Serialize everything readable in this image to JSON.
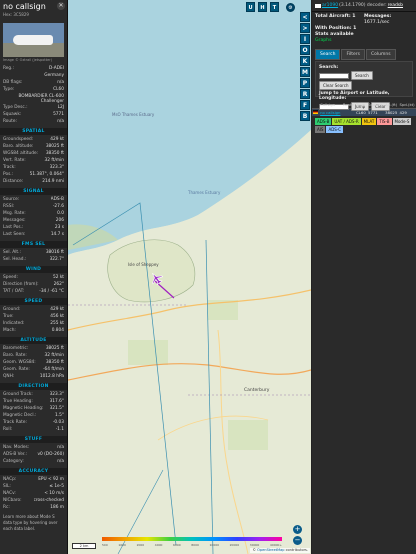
{
  "aircraft": {
    "callsign": "no callsign",
    "hex_line": "Hex: 3C5829",
    "photo_credit": "Image © Oztrail (jetspotter)",
    "fields": [
      {
        "label": "Reg.:",
        "value": "D-ADEI"
      },
      {
        "label": "",
        "value": "Germany"
      },
      {
        "label": "DB flags:",
        "value": "n/a"
      },
      {
        "label": "Type:",
        "value": "CL60"
      },
      {
        "label": "",
        "value": "BOMBARDIER CL-600 Challenger"
      },
      {
        "label": "Type Desc.:",
        "value": "L2J"
      },
      {
        "label": "Squawk:",
        "value": "5771"
      },
      {
        "label": "Route:",
        "value": "n/a"
      }
    ]
  },
  "sections": [
    {
      "title": "SPATIAL",
      "rows": [
        {
          "label": "Groundspeed:",
          "value": "429 kt"
        },
        {
          "label": "Baro. altitude:",
          "value": "38025 ft"
        },
        {
          "label": "WGS84 altitude:",
          "value": "38350 ft"
        },
        {
          "label": "Vert. Rate:",
          "value": "32 ft/min"
        },
        {
          "label": "Track:",
          "value": "323.3°"
        },
        {
          "label": "Pos.:",
          "value": "51.387°, 0.064°"
        },
        {
          "label": "Distance:",
          "value": "214.9 nmi"
        }
      ]
    },
    {
      "title": "SIGNAL",
      "rows": [
        {
          "label": "Source:",
          "value": "ADS-B"
        },
        {
          "label": "RSSI:",
          "value": "-27.6"
        },
        {
          "label": "Msg. Rate:",
          "value": "0.0"
        },
        {
          "label": "Messages:",
          "value": "206"
        },
        {
          "label": "Last Pos.:",
          "value": "23 s"
        },
        {
          "label": "Last Seen:",
          "value": "14.7 s"
        }
      ]
    },
    {
      "title": "FMS SEL",
      "rows": [
        {
          "label": "Sel. Alt.:",
          "value": "38016 ft"
        },
        {
          "label": "Sel. Head.:",
          "value": "322.7°"
        }
      ]
    },
    {
      "title": "WIND",
      "rows": [
        {
          "label": "Speed:",
          "value": "52 kt"
        },
        {
          "label": "Direction (from):",
          "value": "262°"
        },
        {
          "label": "TAT / OAT:",
          "value": "-34 / -61 °C"
        }
      ]
    },
    {
      "title": "SPEED",
      "rows": [
        {
          "label": "Ground:",
          "value": "429 kt"
        },
        {
          "label": "True:",
          "value": "456 kt"
        },
        {
          "label": "Indicated:",
          "value": "255 kt"
        },
        {
          "label": "Mach:",
          "value": "0.804"
        }
      ]
    },
    {
      "title": "ALTITUDE",
      "rows": [
        {
          "label": "Barometric:",
          "value": "38025 ft"
        },
        {
          "label": "Baro. Rate:",
          "value": "32 ft/min"
        },
        {
          "label": "Geom. WGS84:",
          "value": "38350 ft"
        },
        {
          "label": "Geom. Rate:",
          "value": "-64 ft/min"
        },
        {
          "label": "QNH:",
          "value": "1012.8 hPa"
        }
      ]
    },
    {
      "title": "DIRECTION",
      "rows": [
        {
          "label": "Ground Track:",
          "value": "323.3°"
        },
        {
          "label": "True Heading:",
          "value": "317.6°"
        },
        {
          "label": "Magnetic Heading:",
          "value": "321.5°"
        },
        {
          "label": "Magnetic Decl.:",
          "value": "1.5°"
        },
        {
          "label": "Track Rate:",
          "value": "-0.03"
        },
        {
          "label": "Roll:",
          "value": "-1.1"
        }
      ]
    },
    {
      "title": "STUFF",
      "rows": [
        {
          "label": "Nav. Modes:",
          "value": "n/a"
        },
        {
          "label": "ADS-B Ver.:",
          "value": "v0 (DO-260)"
        },
        {
          "label": "Category:",
          "value": "n/a"
        }
      ]
    },
    {
      "title": "ACCURACY",
      "rows": [
        {
          "label": "NACp:",
          "value": "EPU < 92 m"
        },
        {
          "label": "SIL:",
          "value": "≤ 1e-5"
        },
        {
          "label": "NACv:",
          "value": "< 10 m/s"
        },
        {
          "label": "NICbaro:",
          "value": "cross-checked"
        },
        {
          "label": "Rc:",
          "value": "186 m"
        }
      ]
    }
  ],
  "learn_more": "Learn more about Mode S data type by hovering over each data label.",
  "map": {
    "buttons_top": [
      "U",
      "H",
      "T"
    ],
    "labels": {
      "sheppey": "Isle of Sheppey",
      "thames": "Thames Estuary",
      "canterbury": "Canterbury",
      "mso": "MsO Thames Estuary"
    },
    "zoom_in": "+",
    "zoom_out": "−",
    "scale_text": "2 km",
    "legend_ticks": [
      "500",
      "1000",
      "2000",
      "4000",
      "6000",
      "8000",
      "10000",
      "20000",
      "30000",
      "40000+"
    ],
    "attribution_prefix": "© ",
    "attribution_link": "OpenStreetMap",
    "attribution_suffix": " contributors."
  },
  "side_buttons": [
    "<",
    ">",
    "I",
    "O",
    "K",
    "M",
    "P",
    "R",
    "F",
    "B"
  ],
  "sidebar": {
    "decoder_link": "ar1090",
    "decoder_version": "(3.14.1790) decoder:",
    "decoder_name": "readsb",
    "stats": {
      "total_label": "Total Aircraft: 1",
      "messages_label": "Messages:",
      "messages_value": "1677.1/sec",
      "with_position": "With Position: 1",
      "stats_available": "Stats available",
      "graphs": "Graphs"
    },
    "tabs": [
      "Search",
      "Filters",
      "Columns"
    ],
    "search_label": "Search:",
    "search_button": "Search",
    "clear_search": "Clear Search",
    "jump_label": "Jump to Airport or Latitude, Longitude:",
    "jump_button": "Jump",
    "clear_button": "Clear",
    "table_headers": [
      "",
      "Callsign",
      "Route",
      "Type",
      "Squawk",
      "Alt.(ft)",
      "Spd.(kt)"
    ],
    "rows": [
      {
        "callsign": "no callsign",
        "route": "",
        "type": "CL60",
        "squawk": "5771",
        "alt": "38025",
        "spd": "429"
      }
    ],
    "source_legend": [
      {
        "label": "ADS-B",
        "color": "#2ecc71"
      },
      {
        "label": "UAT / ADS-R",
        "color": "#a6e22e"
      },
      {
        "label": "MLAT",
        "color": "#f1c40f"
      },
      {
        "label": "TIS-B",
        "color": "#ff9999"
      },
      {
        "label": "Mode-S",
        "color": "#cccccc"
      },
      {
        "label": "AIS",
        "color": "#777777"
      },
      {
        "label": "ADS-C",
        "color": "#88c0ff"
      }
    ]
  }
}
